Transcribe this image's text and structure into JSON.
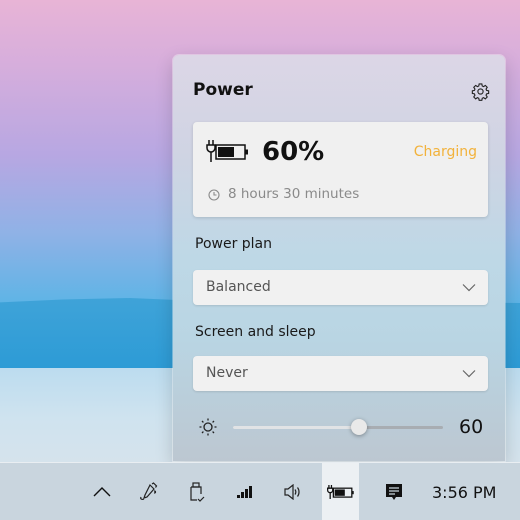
{
  "flyout": {
    "title": "Power",
    "settings_icon": "gear-icon",
    "battery": {
      "icon": "battery-charging-icon",
      "percent_label": "60%",
      "percent": 60,
      "status": "Charging",
      "status_color": "#f2b23b",
      "time_icon": "clock-icon",
      "time_remaining": "8 hours 30 minutes"
    },
    "power_plan": {
      "label": "Power plan",
      "selected": "Balanced"
    },
    "screen_sleep": {
      "label": "Screen and sleep",
      "selected": "Never"
    },
    "brightness": {
      "icon": "sun-icon",
      "value": 60,
      "value_label": "60",
      "min": 0,
      "max": 100
    }
  },
  "taskbar": {
    "tray_icons": [
      {
        "name": "show-hidden-icons",
        "icon": "chevron-up-icon"
      },
      {
        "name": "pen-workspace",
        "icon": "pen-icon"
      },
      {
        "name": "safely-remove-hardware",
        "icon": "usb-drive-icon"
      },
      {
        "name": "network",
        "icon": "cellular-signal-icon"
      },
      {
        "name": "volume",
        "icon": "speaker-icon"
      },
      {
        "name": "battery",
        "icon": "battery-charging-icon",
        "active": true
      },
      {
        "name": "action-center",
        "icon": "notification-icon"
      }
    ],
    "clock": "3:56 PM"
  }
}
